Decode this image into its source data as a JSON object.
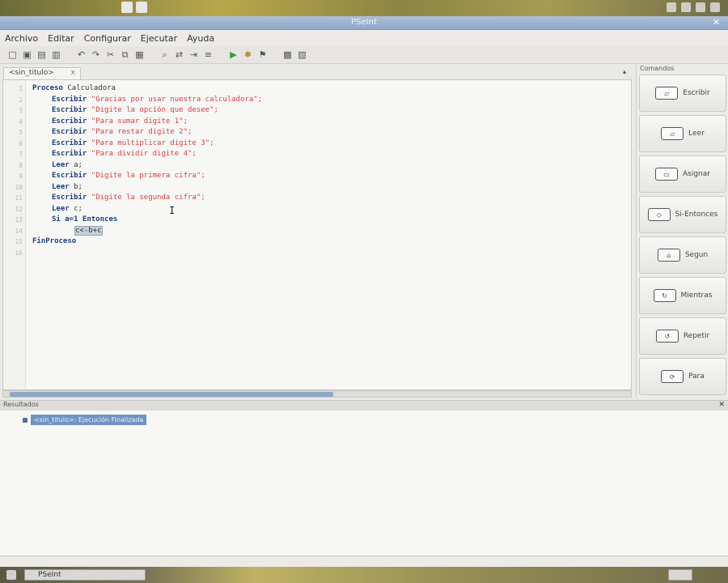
{
  "window": {
    "title": "PSeInt"
  },
  "menu": [
    "Archivo",
    "Editar",
    "Configurar",
    "Ejecutar",
    "Ayuda"
  ],
  "toolbar_icons": [
    "new-file-icon",
    "open-folder-icon",
    "save-icon",
    "save-as-icon",
    "undo-icon",
    "redo-icon",
    "cut-icon",
    "copy-icon",
    "paste-icon",
    "search-icon",
    "replace-icon",
    "find-next-icon",
    "indent-icon",
    "run-icon",
    "step-run-icon",
    "debug-icon",
    "flowchart-icon",
    "print-icon"
  ],
  "editor": {
    "tab_label": "<sin_titulo>",
    "tab_close": "x",
    "tab_menu": "▴",
    "line_numbers": [
      "1",
      "2",
      "3",
      "4",
      "5",
      "6",
      "7",
      "8",
      "9",
      "10",
      "11",
      "12",
      "13",
      "14",
      "15",
      "16"
    ],
    "lines": [
      {
        "kw": "Proceso",
        "rest": " Calculadora"
      },
      {
        "kw": "Escribir",
        "str": " \"Gracias por usar nuestra calculadora\";"
      },
      {
        "kw": "Escribir",
        "str": " \"Digite la opción que desee\";"
      },
      {
        "kw": "Escribir",
        "str": " \"Para sumar digite 1\";"
      },
      {
        "kw": "Escribir",
        "str": " \"Para restar digite 2\";"
      },
      {
        "kw": "Escribir",
        "str": " \"Para multiplicar digite 3\";"
      },
      {
        "kw": "Escribir",
        "str": " \"Para dividir digite 4\";"
      },
      {
        "kw": "Leer",
        "rest": " a;"
      },
      {
        "kw": "Escribir",
        "str": " \"Digite la primera cifra\";"
      },
      {
        "kw": "Leer",
        "rest": " b;"
      },
      {
        "kw": "Escribir",
        "str": " \"Digite la segunda cifra\";"
      },
      {
        "kw": "Leer",
        "rest": " c;"
      },
      {
        "kw": "Si a=1 Entonces",
        "rest": ""
      },
      {
        "sel": "c<-b+c"
      },
      {
        "kw": "FinProceso",
        "rest": ""
      },
      {
        "rest": ""
      }
    ]
  },
  "commands": {
    "title": "Comandos",
    "items": [
      {
        "label": "Escribir",
        "icon": "escribir-icon"
      },
      {
        "label": "Leer",
        "icon": "leer-icon"
      },
      {
        "label": "Asignar",
        "icon": "asignar-icon"
      },
      {
        "label": "Si-Entonces",
        "icon": "si-entonces-icon"
      },
      {
        "label": "Segun",
        "icon": "segun-icon"
      },
      {
        "label": "Mientras",
        "icon": "mientras-icon"
      },
      {
        "label": "Repetir",
        "icon": "repetir-icon"
      },
      {
        "label": "Para",
        "icon": "para-icon"
      }
    ]
  },
  "results": {
    "title": "Resultados",
    "close": "✕",
    "item": "<sin_titulo>: Ejecución Finalizada"
  },
  "taskbar": {
    "window_label": "PSeInt"
  },
  "colors": {
    "keyword": "#1c3d7a",
    "string": "#d44242",
    "selection": "#7093c2",
    "titlebar": "#8fa7c8"
  }
}
